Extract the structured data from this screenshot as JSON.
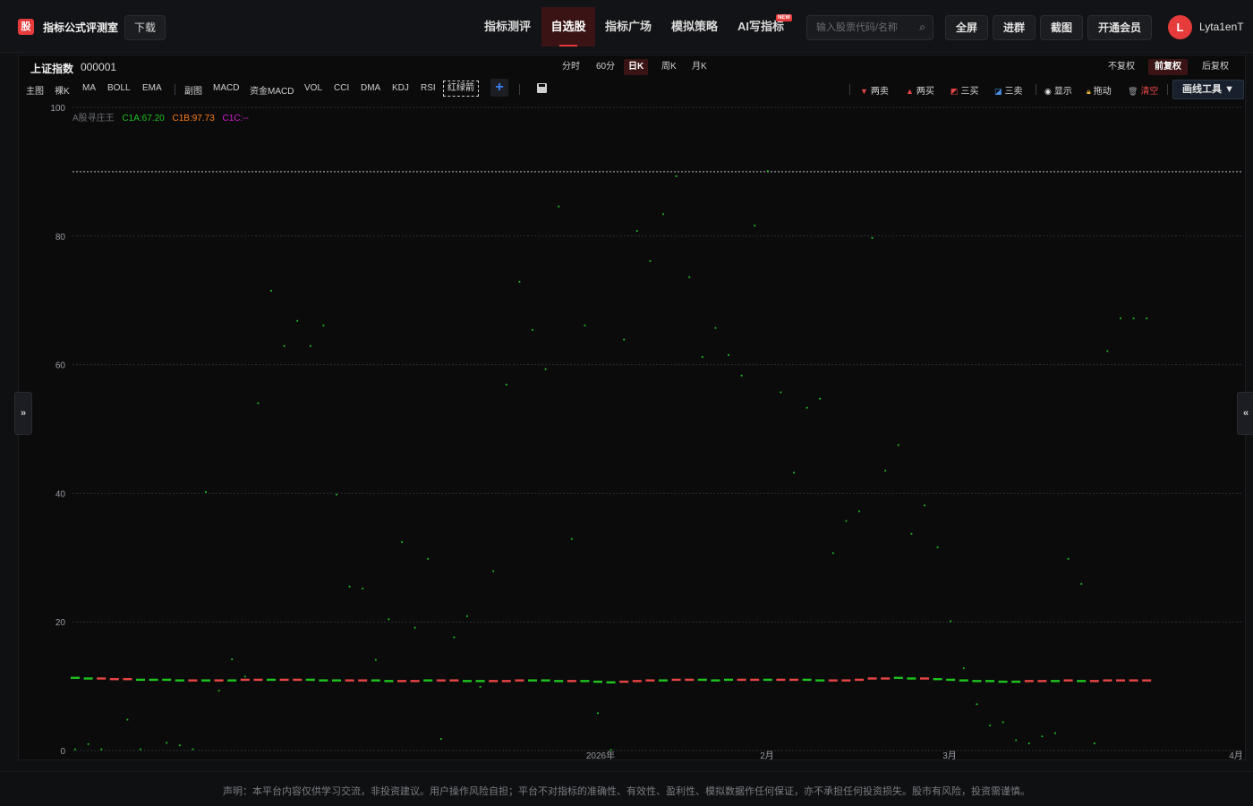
{
  "header": {
    "logo_glyph": "股",
    "brand": "指标公式评测室",
    "download": "下载",
    "nav": [
      {
        "label": "指标测评",
        "active": false
      },
      {
        "label": "自选股",
        "active": true
      },
      {
        "label": "指标广场",
        "active": false
      },
      {
        "label": "模拟策略",
        "active": false
      },
      {
        "label": "AI写指标",
        "active": false
      }
    ],
    "new_badge": "NEW",
    "search_placeholder": "输入股票代码/名称",
    "buttons": {
      "fullscreen": "全屏",
      "join_group": "进群",
      "screenshot": "截图",
      "vip": "开通会员"
    },
    "user": {
      "initial": "L",
      "name": "Lyta1enT"
    }
  },
  "stock": {
    "name": "上证指数",
    "code": "000001"
  },
  "periods": [
    {
      "label": "分时",
      "active": false
    },
    {
      "label": "60分",
      "active": false
    },
    {
      "label": "日K",
      "active": true
    },
    {
      "label": "周K",
      "active": false
    },
    {
      "label": "月K",
      "active": false
    }
  ],
  "adjust": [
    {
      "label": "不复权",
      "active": false
    },
    {
      "label": "前复权",
      "active": true
    },
    {
      "label": "后复权",
      "active": false
    }
  ],
  "indicators_main": {
    "main_label": "主图",
    "items": [
      "裸K",
      "MA",
      "BOLL",
      "EMA"
    ]
  },
  "indicators_sub": {
    "sub_label": "副图",
    "items": [
      "MACD",
      "资金MACD",
      "VOL",
      "CCI",
      "DMA",
      "KDJ",
      "RSI"
    ],
    "active_tag": "红绿箭"
  },
  "add_button": "+",
  "tools": {
    "sell2": "两卖",
    "buy2": "两买",
    "buy3": "三买",
    "sell3": "三卖",
    "show": "显示",
    "drag": "拖动",
    "clear": "清空",
    "draw": "画线工具"
  },
  "legend": {
    "name": "A股寻庄王",
    "c1a": "C1A:67.20",
    "c1b": "C1B:97.73",
    "c1c": "C1C:--",
    "c1a_color": "#1ec41e",
    "c1b_color": "#ff7f1a",
    "c1c_color": "#d61ed6"
  },
  "chart_data": {
    "type": "scatter",
    "y_ticks": [
      "100",
      "80",
      "60",
      "40",
      "20",
      "0"
    ],
    "ylim": [
      0,
      100
    ],
    "x_ticks": [
      "2026年",
      "2月",
      "3月",
      "4月"
    ],
    "reference_line": 90,
    "green_points": [
      [
        1,
        0.2
      ],
      [
        2,
        1
      ],
      [
        3,
        0.2
      ],
      [
        5,
        4.8
      ],
      [
        6,
        0.2
      ],
      [
        8,
        1.2
      ],
      [
        9,
        0.8
      ],
      [
        10,
        0.2
      ],
      [
        11,
        40.2
      ],
      [
        12,
        9.3
      ],
      [
        13,
        14.2
      ],
      [
        14,
        11.5
      ],
      [
        15,
        54
      ],
      [
        16,
        71.5
      ],
      [
        17,
        62.9
      ],
      [
        18,
        66.8
      ],
      [
        19,
        62.9
      ],
      [
        20,
        66.1
      ],
      [
        21,
        39.8
      ],
      [
        22,
        25.5
      ],
      [
        23,
        25.2
      ],
      [
        24,
        14.1
      ],
      [
        25,
        20.4
      ],
      [
        26,
        32.4
      ],
      [
        27,
        19.1
      ],
      [
        28,
        29.8
      ],
      [
        29,
        1.8
      ],
      [
        30,
        17.6
      ],
      [
        31,
        20.9
      ],
      [
        32,
        9.9
      ],
      [
        33,
        27.9
      ],
      [
        34,
        56.9
      ],
      [
        35,
        72.9
      ],
      [
        36,
        65.4
      ],
      [
        37,
        59.3
      ],
      [
        38,
        84.6
      ],
      [
        39,
        32.9
      ],
      [
        40,
        66.1
      ],
      [
        41,
        5.8
      ],
      [
        42,
        0.1
      ],
      [
        43,
        63.9
      ],
      [
        44,
        80.8
      ],
      [
        45,
        76.1
      ],
      [
        46,
        83.4
      ],
      [
        47,
        89.3
      ],
      [
        48,
        73.6
      ],
      [
        49,
        61.2
      ],
      [
        50,
        65.7
      ],
      [
        51,
        61.5
      ],
      [
        52,
        58.3
      ],
      [
        53,
        81.6
      ],
      [
        54,
        90.1
      ],
      [
        55,
        55.7
      ],
      [
        56,
        43.2
      ],
      [
        57,
        53.3
      ],
      [
        58,
        54.7
      ],
      [
        59,
        30.7
      ],
      [
        60,
        35.7
      ],
      [
        61,
        37.2
      ],
      [
        62,
        79.7
      ],
      [
        63,
        43.5
      ],
      [
        64,
        47.5
      ],
      [
        65,
        33.7
      ],
      [
        66,
        38.1
      ],
      [
        67,
        31.6
      ],
      [
        68,
        20.1
      ],
      [
        69,
        12.8
      ],
      [
        70,
        7.2
      ],
      [
        71,
        3.9
      ],
      [
        72,
        4.4
      ],
      [
        73,
        1.6
      ],
      [
        74,
        1.1
      ],
      [
        75,
        2.2
      ],
      [
        76,
        2.7
      ],
      [
        77,
        29.8
      ],
      [
        78,
        25.9
      ],
      [
        79,
        1.1
      ],
      [
        80,
        62.1
      ],
      [
        81,
        67.2
      ],
      [
        82,
        67.2
      ],
      [
        83,
        67.2
      ]
    ],
    "candles": [
      {
        "x": 1,
        "c": "g",
        "y": 11.3
      },
      {
        "x": 2,
        "c": "g",
        "y": 11.2
      },
      {
        "x": 3,
        "c": "r",
        "y": 11.2
      },
      {
        "x": 4,
        "c": "r",
        "y": 11.1
      },
      {
        "x": 5,
        "c": "r",
        "y": 11.1
      },
      {
        "x": 6,
        "c": "g",
        "y": 11.0
      },
      {
        "x": 7,
        "c": "g",
        "y": 11.0
      },
      {
        "x": 8,
        "c": "g",
        "y": 11.0
      },
      {
        "x": 9,
        "c": "g",
        "y": 10.9
      },
      {
        "x": 10,
        "c": "r",
        "y": 10.9
      },
      {
        "x": 11,
        "c": "g",
        "y": 10.9
      },
      {
        "x": 12,
        "c": "r",
        "y": 10.9
      },
      {
        "x": 13,
        "c": "g",
        "y": 10.9
      },
      {
        "x": 14,
        "c": "r",
        "y": 11.0
      },
      {
        "x": 15,
        "c": "r",
        "y": 11.0
      },
      {
        "x": 16,
        "c": "g",
        "y": 11.0
      },
      {
        "x": 17,
        "c": "r",
        "y": 11.0
      },
      {
        "x": 18,
        "c": "r",
        "y": 11.0
      },
      {
        "x": 19,
        "c": "g",
        "y": 11.0
      },
      {
        "x": 20,
        "c": "g",
        "y": 10.9
      },
      {
        "x": 21,
        "c": "g",
        "y": 10.9
      },
      {
        "x": 22,
        "c": "r",
        "y": 10.9
      },
      {
        "x": 23,
        "c": "r",
        "y": 10.9
      },
      {
        "x": 24,
        "c": "g",
        "y": 10.9
      },
      {
        "x": 25,
        "c": "g",
        "y": 10.8
      },
      {
        "x": 26,
        "c": "r",
        "y": 10.8
      },
      {
        "x": 27,
        "c": "r",
        "y": 10.8
      },
      {
        "x": 28,
        "c": "g",
        "y": 10.9
      },
      {
        "x": 29,
        "c": "r",
        "y": 10.9
      },
      {
        "x": 30,
        "c": "r",
        "y": 10.9
      },
      {
        "x": 31,
        "c": "g",
        "y": 10.8
      },
      {
        "x": 32,
        "c": "g",
        "y": 10.8
      },
      {
        "x": 33,
        "c": "r",
        "y": 10.8
      },
      {
        "x": 34,
        "c": "r",
        "y": 10.8
      },
      {
        "x": 35,
        "c": "r",
        "y": 10.9
      },
      {
        "x": 36,
        "c": "g",
        "y": 10.9
      },
      {
        "x": 37,
        "c": "g",
        "y": 10.9
      },
      {
        "x": 38,
        "c": "g",
        "y": 10.8
      },
      {
        "x": 39,
        "c": "r",
        "y": 10.8
      },
      {
        "x": 40,
        "c": "g",
        "y": 10.8
      },
      {
        "x": 41,
        "c": "g",
        "y": 10.7
      },
      {
        "x": 42,
        "c": "g",
        "y": 10.6
      },
      {
        "x": 43,
        "c": "r",
        "y": 10.7
      },
      {
        "x": 44,
        "c": "r",
        "y": 10.8
      },
      {
        "x": 45,
        "c": "r",
        "y": 10.9
      },
      {
        "x": 46,
        "c": "g",
        "y": 10.9
      },
      {
        "x": 47,
        "c": "r",
        "y": 11.0
      },
      {
        "x": 48,
        "c": "r",
        "y": 11.0
      },
      {
        "x": 49,
        "c": "g",
        "y": 11.0
      },
      {
        "x": 50,
        "c": "g",
        "y": 10.9
      },
      {
        "x": 51,
        "c": "g",
        "y": 11.0
      },
      {
        "x": 52,
        "c": "r",
        "y": 11.0
      },
      {
        "x": 53,
        "c": "r",
        "y": 11.0
      },
      {
        "x": 54,
        "c": "g",
        "y": 11.0
      },
      {
        "x": 55,
        "c": "r",
        "y": 11.0
      },
      {
        "x": 56,
        "c": "r",
        "y": 11.0
      },
      {
        "x": 57,
        "c": "g",
        "y": 11.0
      },
      {
        "x": 58,
        "c": "g",
        "y": 10.9
      },
      {
        "x": 59,
        "c": "r",
        "y": 10.9
      },
      {
        "x": 60,
        "c": "r",
        "y": 10.9
      },
      {
        "x": 61,
        "c": "r",
        "y": 11.0
      },
      {
        "x": 62,
        "c": "r",
        "y": 11.2
      },
      {
        "x": 63,
        "c": "r",
        "y": 11.2
      },
      {
        "x": 64,
        "c": "g",
        "y": 11.3
      },
      {
        "x": 65,
        "c": "g",
        "y": 11.2
      },
      {
        "x": 66,
        "c": "r",
        "y": 11.2
      },
      {
        "x": 67,
        "c": "g",
        "y": 11.1
      },
      {
        "x": 68,
        "c": "g",
        "y": 11.0
      },
      {
        "x": 69,
        "c": "g",
        "y": 10.9
      },
      {
        "x": 70,
        "c": "g",
        "y": 10.8
      },
      {
        "x": 71,
        "c": "g",
        "y": 10.8
      },
      {
        "x": 72,
        "c": "g",
        "y": 10.7
      },
      {
        "x": 73,
        "c": "g",
        "y": 10.7
      },
      {
        "x": 74,
        "c": "r",
        "y": 10.8
      },
      {
        "x": 75,
        "c": "r",
        "y": 10.8
      },
      {
        "x": 76,
        "c": "g",
        "y": 10.8
      },
      {
        "x": 77,
        "c": "r",
        "y": 10.9
      },
      {
        "x": 78,
        "c": "g",
        "y": 10.8
      },
      {
        "x": 79,
        "c": "r",
        "y": 10.8
      },
      {
        "x": 80,
        "c": "r",
        "y": 10.9
      },
      {
        "x": 81,
        "c": "r",
        "y": 10.9
      },
      {
        "x": 82,
        "c": "r",
        "y": 10.9
      },
      {
        "x": 83,
        "c": "r",
        "y": 10.9
      }
    ],
    "up_color": "#e84545",
    "down_color": "#1ec41e",
    "grid": true
  },
  "side_toggles": {
    "left": "»",
    "right": "«"
  },
  "footer": "声明：本平台内容仅供学习交流，非投资建议。用户操作风险自担；平台不对指标的准确性、有效性、盈利性、模拟数据作任何保证，亦不承担任何投资损失。股市有风险，投资需谨慎。"
}
